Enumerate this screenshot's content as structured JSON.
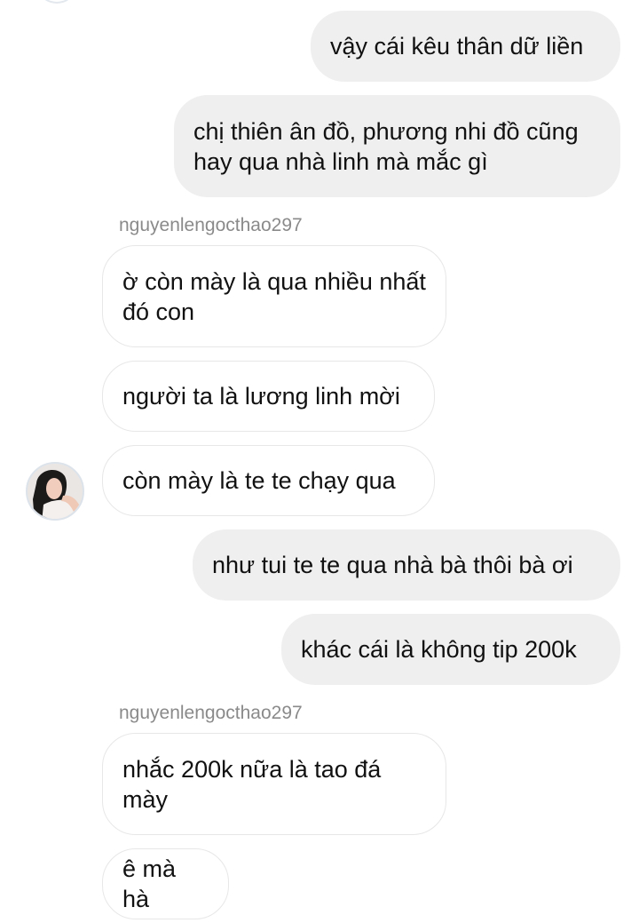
{
  "conversation": {
    "messages": [
      {
        "direction": "out",
        "text": "vậy cái kêu thân dữ liền"
      },
      {
        "direction": "out",
        "text": "chị thiên ân đồ, phương nhi đồ cũng hay qua nhà linh mà mắc gì"
      },
      {
        "direction": "in",
        "text": "ờ còn mày là qua nhiều nhất đó con"
      },
      {
        "direction": "in",
        "text": "người ta là lương linh mời"
      },
      {
        "direction": "in",
        "text": "còn mày là te te chạy qua"
      },
      {
        "direction": "out",
        "text": "như tui te te qua nhà bà thôi bà ơi"
      },
      {
        "direction": "out",
        "text": "khác cái là không tip 200k"
      },
      {
        "direction": "in",
        "text": "nhắc 200k nữa là tao đá mày"
      },
      {
        "direction": "in",
        "text": "ê mà hà"
      }
    ],
    "sender_labels": [
      {
        "username": "nguyenlengocthao297"
      },
      {
        "username": "nguyenlengocthao297"
      }
    ]
  },
  "colors": {
    "outgoing_bubble": "#efefef",
    "incoming_bubble_border": "#e7e7e7",
    "sender_label": "#8a8a8a",
    "text": "#111111"
  },
  "icons": {
    "contact_avatar": "avatar-photo"
  }
}
